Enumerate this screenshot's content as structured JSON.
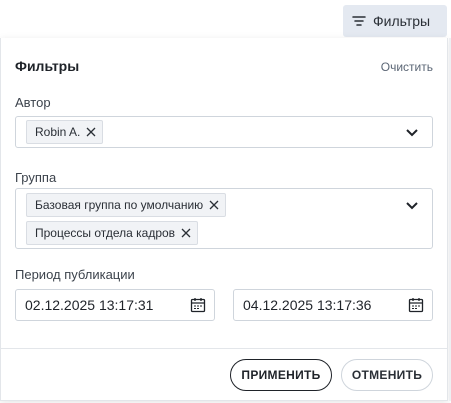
{
  "toolbar": {
    "filter_button_label": "Фильтры",
    "filter_icon": "filter-lines-icon"
  },
  "panel": {
    "title": "Фильтры",
    "clear_label": "Очистить",
    "author": {
      "label": "Автор",
      "chips": [
        "Robin A."
      ]
    },
    "group": {
      "label": "Группа",
      "chips": [
        "Базовая группа по умолчанию",
        "Процессы отдела кадров"
      ]
    },
    "period": {
      "label": "Период публикации",
      "from": "02.12.2025 13:17:31",
      "to": "04.12.2025 13:17:36"
    },
    "apply_label": "ПРИМЕНИТЬ",
    "cancel_label": "ОТМЕНИТЬ"
  }
}
